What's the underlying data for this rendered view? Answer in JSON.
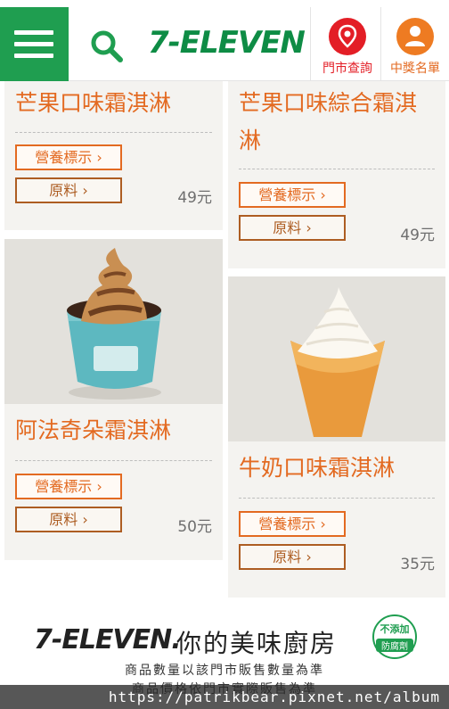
{
  "header": {
    "logo_text": "7-ELEVEN",
    "store_locator_label": "門市查詢",
    "winners_label": "中獎名單"
  },
  "cards": [
    {
      "name": "芒果口味霜淇淋",
      "nutrition_label": "營養標示 ›",
      "ingredients_label": "原料 ›",
      "price": "49元"
    },
    {
      "name": "芒果口味綜合霜淇淋",
      "nutrition_label": "營養標示 ›",
      "ingredients_label": "原料 ›",
      "price": "49元"
    },
    {
      "name": "阿法奇朵霜淇淋",
      "nutrition_label": "營養標示 ›",
      "ingredients_label": "原料 ›",
      "price": "50元"
    },
    {
      "name": "牛奶口味霜淇淋",
      "nutrition_label": "營養標示 ›",
      "ingredients_label": "原料 ›",
      "price": "35元"
    }
  ],
  "footer": {
    "logo_text": "7-ELEVEN.",
    "tagline": "你的美味廚房",
    "badge_top": "不添加",
    "badge_bottom": "防腐劑",
    "note_quantity": "商品數量以該門市販售數量為準",
    "note_price": "商品價格依門市實際販售為準"
  },
  "watermark": "https://patrikbear.pixnet.net/album",
  "colors": {
    "brand_green": "#1f9e50",
    "brand_orange": "#e36a21",
    "brand_red": "#e31e26"
  }
}
